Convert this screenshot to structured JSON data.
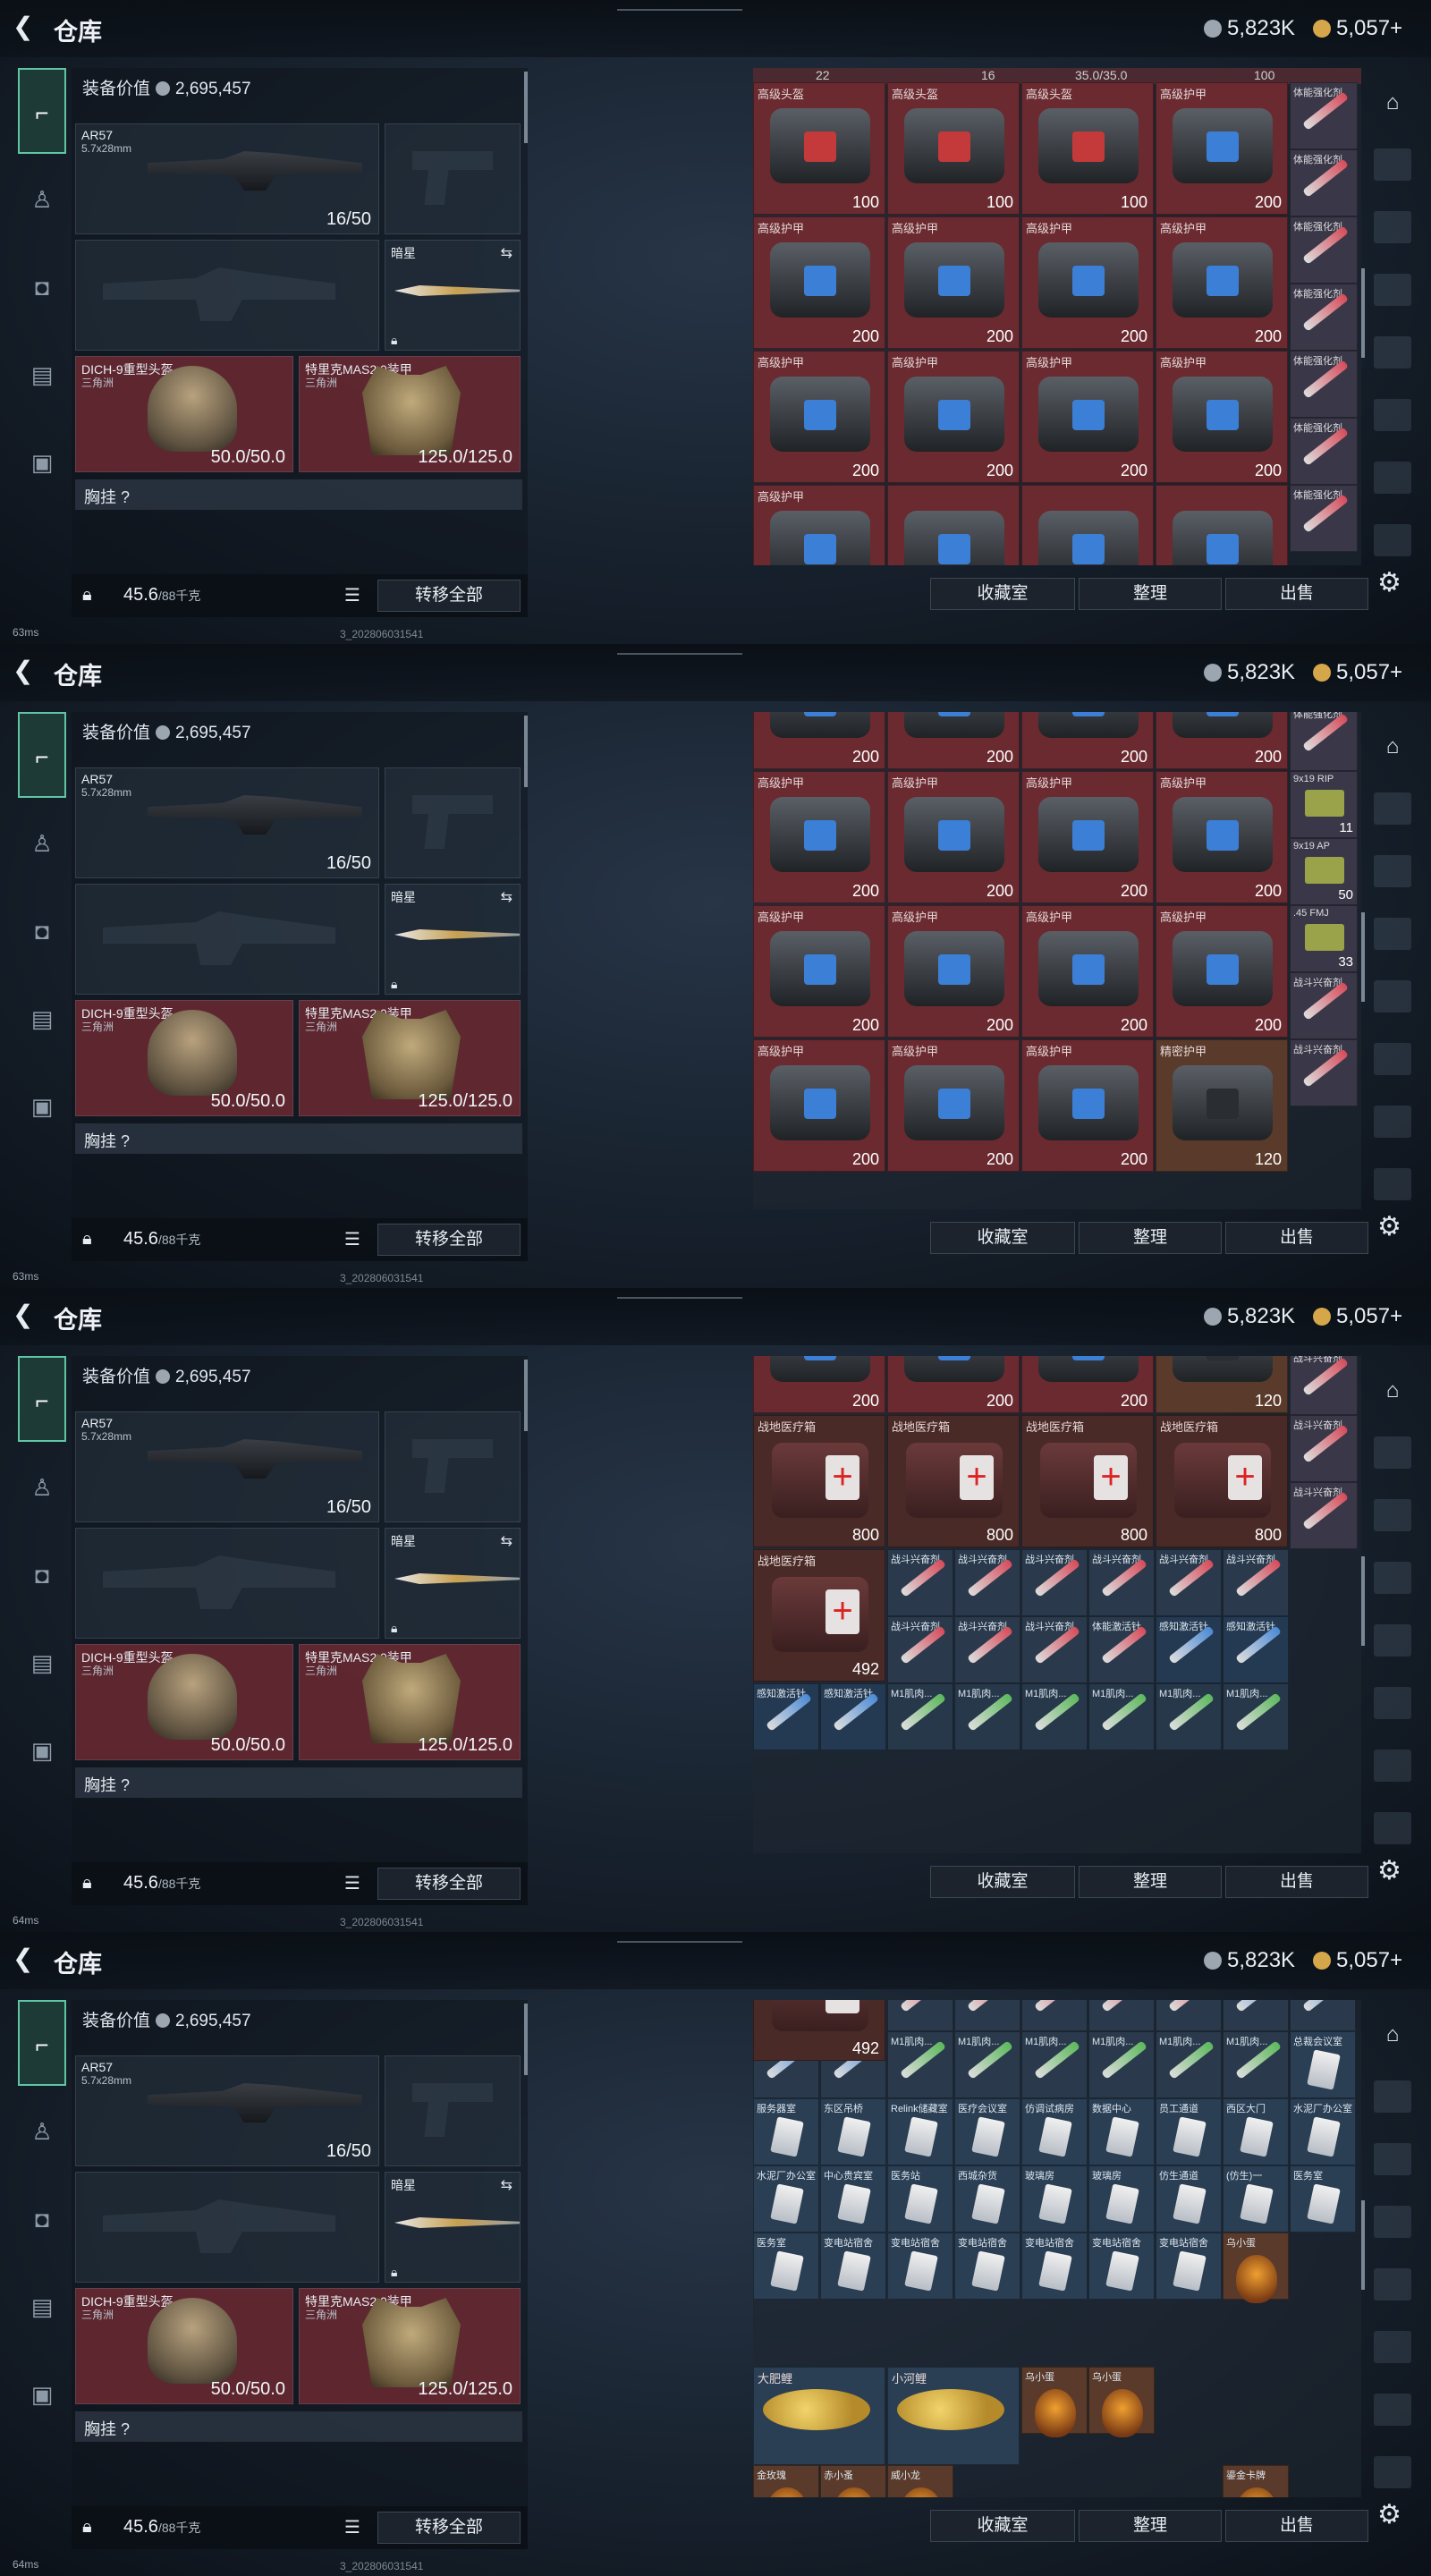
{
  "header": {
    "title": "仓库",
    "currency_silver": "5,823K",
    "currency_gold": "5,057",
    "plus": "+"
  },
  "left": {
    "value_label": "装备价值",
    "value": "2,695,457",
    "weapon_name": "AR57",
    "weapon_caliber": "5.7x28mm",
    "weapon_ammo": "16/50",
    "knife_name": "暗星",
    "helmet_name": "DICH-9重型头盔",
    "helmet_tag": "三角洲",
    "helmet_dur": "50.0/50.0",
    "armor_name": "特里克MAS2.0装甲",
    "armor_dur": "125.0/125.0",
    "chest_label": "胸挂",
    "weight": "45.6",
    "weight_unit": "/88千克",
    "transfer_label": "转移全部"
  },
  "buttons": {
    "collection": "收藏室",
    "sort": "整理",
    "sell": "出售"
  },
  "debug": {
    "ping1": "63ms",
    "ping3": "64ms",
    "version": "3_202806031541"
  },
  "frames": [
    {
      "cells": [
        {
          "n": "高级头盔",
          "v": "100",
          "t": "rb"
        },
        {
          "n": "高级头盔",
          "v": "100",
          "t": "rb"
        },
        {
          "n": "高级头盔",
          "v": "100",
          "t": "rb"
        },
        {
          "n": "高级护甲",
          "v": "200",
          "t": "b"
        },
        {
          "n": "高级护甲",
          "v": "200",
          "t": "b"
        },
        {
          "n": "高级护甲",
          "v": "200",
          "t": "b"
        },
        {
          "n": "高级护甲",
          "v": "200",
          "t": "b"
        },
        {
          "n": "高级护甲",
          "v": "200",
          "t": "b"
        },
        {
          "n": "高级护甲",
          "v": "200",
          "t": "b"
        },
        {
          "n": "高级护甲",
          "v": "200",
          "t": "b"
        },
        {
          "n": "高级护甲",
          "v": "200",
          "t": "b"
        },
        {
          "n": "高级护甲",
          "v": "200",
          "t": "b"
        },
        {
          "n": "高级护甲",
          "v": "",
          "t": "b"
        },
        {
          "n": "",
          "v": "",
          "t": "b"
        },
        {
          "n": "",
          "v": "",
          "t": "b"
        },
        {
          "n": "",
          "v": "",
          "t": "b"
        }
      ],
      "side": [
        {
          "n": "体能强化剂",
          "v": ""
        },
        {
          "n": "体能强化剂",
          "v": ""
        },
        {
          "n": "体能强化剂",
          "v": ""
        },
        {
          "n": "体能强化剂",
          "v": ""
        },
        {
          "n": "体能强化剂",
          "v": ""
        },
        {
          "n": "体能强化剂",
          "v": ""
        },
        {
          "n": "体能强化剂",
          "v": ""
        }
      ],
      "top": [
        "22",
        "16",
        "35.0/35.0",
        "100"
      ]
    },
    {
      "cells": [
        {
          "n": "",
          "v": "200",
          "t": "b"
        },
        {
          "n": "",
          "v": "200",
          "t": "b"
        },
        {
          "n": "",
          "v": "200",
          "t": "b"
        },
        {
          "n": "",
          "v": "200",
          "t": "b"
        },
        {
          "n": "高级护甲",
          "v": "200",
          "t": "b"
        },
        {
          "n": "高级护甲",
          "v": "200",
          "t": "b"
        },
        {
          "n": "高级护甲",
          "v": "200",
          "t": "b"
        },
        {
          "n": "高级护甲",
          "v": "200",
          "t": "b"
        },
        {
          "n": "高级护甲",
          "v": "200",
          "t": "b"
        },
        {
          "n": "高级护甲",
          "v": "200",
          "t": "b"
        },
        {
          "n": "高级护甲",
          "v": "200",
          "t": "b"
        },
        {
          "n": "高级护甲",
          "v": "200",
          "t": "b"
        },
        {
          "n": "高级护甲",
          "v": "200",
          "t": "b"
        },
        {
          "n": "高级护甲",
          "v": "200",
          "t": "b"
        },
        {
          "n": "高级护甲",
          "v": "200",
          "t": "b"
        },
        {
          "n": "精密护甲",
          "v": "120",
          "t": "db"
        }
      ],
      "side": [
        {
          "n": "体能强化剂",
          "v": ""
        },
        {
          "n": "体能强化剂",
          "v": ""
        },
        {
          "n": "9x19 RIP",
          "v": "11"
        },
        {
          "n": "9x19 AP",
          "v": "50"
        },
        {
          "n": ".45 FMJ",
          "v": "33"
        },
        {
          "n": "战斗兴奋剂",
          "v": ""
        },
        {
          "n": "战斗兴奋剂",
          "v": ""
        }
      ],
      "top": []
    },
    {
      "cells": [
        {
          "n": "高级护甲",
          "v": "200",
          "t": "b"
        },
        {
          "n": "高级护甲",
          "v": "200",
          "t": "b"
        },
        {
          "n": "高级护甲",
          "v": "200",
          "t": "b"
        },
        {
          "n": "精密护甲",
          "v": "120",
          "t": "db"
        },
        {
          "n": "战地医疗箱",
          "v": "800",
          "t": "m"
        },
        {
          "n": "战地医疗箱",
          "v": "800",
          "t": "m"
        },
        {
          "n": "战地医疗箱",
          "v": "800",
          "t": "m"
        },
        {
          "n": "战地医疗箱",
          "v": "800",
          "t": "m"
        },
        {
          "n": "战地医疗箱",
          "v": "492",
          "t": "m"
        }
      ],
      "side": [
        {
          "n": "战斗兴奋剂",
          "v": ""
        },
        {
          "n": "战斗兴奋剂",
          "v": ""
        },
        {
          "n": "战斗兴奋剂",
          "v": ""
        },
        {
          "n": "战斗兴奋剂",
          "v": ""
        }
      ],
      "small": [
        {
          "n": "战斗兴奋剂",
          "c": "r"
        },
        {
          "n": "战斗兴奋剂",
          "c": "r"
        },
        {
          "n": "战斗兴奋剂",
          "c": "r"
        },
        {
          "n": "战斗兴奋剂",
          "c": "r"
        },
        {
          "n": "战斗兴奋剂",
          "c": "r"
        },
        {
          "n": "战斗兴奋剂",
          "c": "r"
        },
        {
          "n": "战斗兴奋剂",
          "c": "r"
        },
        {
          "n": "战斗兴奋剂",
          "c": "r"
        },
        {
          "n": "战斗兴奋剂",
          "c": "r"
        },
        {
          "n": "体能激活针",
          "c": "r"
        },
        {
          "n": "感知激活针",
          "c": "b"
        },
        {
          "n": "感知激活针",
          "c": "b"
        },
        {
          "n": "感知激活针",
          "c": "b"
        },
        {
          "n": "感知激活针",
          "c": "b"
        },
        {
          "n": "M1肌肉...",
          "c": "g"
        },
        {
          "n": "M1肌肉...",
          "c": "g"
        },
        {
          "n": "M1肌肉...",
          "c": "g"
        },
        {
          "n": "M1肌肉...",
          "c": "g"
        },
        {
          "n": "M1肌肉...",
          "c": "g"
        },
        {
          "n": "M1肌肉...",
          "c": "g"
        }
      ],
      "top": []
    },
    {
      "cells": [],
      "small": [
        {
          "n": "战斗兴奋剂",
          "c": "r"
        },
        {
          "n": "战斗兴奋剂",
          "c": "r"
        },
        {
          "n": "战斗兴奋剂",
          "c": "r"
        },
        {
          "n": "战斗兴奋剂",
          "c": "r"
        },
        {
          "n": "体能激活针",
          "c": "r"
        },
        {
          "n": "感知激活针",
          "c": "b"
        },
        {
          "n": "感知激活针",
          "c": "b"
        },
        {
          "n": "感知激活针",
          "c": "b"
        },
        {
          "n": "感知激活针",
          "c": "b"
        },
        {
          "n": "M1肌肉...",
          "c": "g"
        },
        {
          "n": "M1肌肉...",
          "c": "g"
        },
        {
          "n": "M1肌肉...",
          "c": "g"
        },
        {
          "n": "M1肌肉...",
          "c": "g"
        },
        {
          "n": "M1肌肉...",
          "c": "g"
        },
        {
          "n": "M1肌肉...",
          "c": "g"
        },
        {
          "n": "总裁会议室",
          "c": "k"
        },
        {
          "n": "服务器室",
          "c": "k"
        },
        {
          "n": "东区吊桥",
          "c": "k"
        },
        {
          "n": "Relink储藏室",
          "c": "k"
        },
        {
          "n": "医疗会议室",
          "c": "k"
        },
        {
          "n": "仿调试病房",
          "c": "k"
        },
        {
          "n": "数据中心",
          "c": "k"
        },
        {
          "n": "员工通道",
          "c": "k"
        },
        {
          "n": "西区大门",
          "c": "k"
        },
        {
          "n": "水泥厂办公室",
          "c": "k"
        },
        {
          "n": "水泥厂办公室",
          "c": "k"
        },
        {
          "n": "中心贵宾室",
          "c": "k"
        },
        {
          "n": "医务站",
          "c": "k"
        },
        {
          "n": "西城杂货",
          "c": "k"
        },
        {
          "n": "玻璃房",
          "c": "k"
        },
        {
          "n": "玻璃房",
          "c": "k"
        },
        {
          "n": "仿生通道",
          "c": "k"
        },
        {
          "n": "(仿生)一",
          "c": "k"
        },
        {
          "n": "医务室",
          "c": "k"
        },
        {
          "n": "医务室",
          "c": "k"
        },
        {
          "n": "变电站宿舍",
          "c": "k"
        },
        {
          "n": "变电站宿舍",
          "c": "k"
        },
        {
          "n": "变电站宿舍",
          "c": "k"
        },
        {
          "n": "变电站宿舍",
          "c": "k"
        },
        {
          "n": "变电站宿舍",
          "c": "k"
        },
        {
          "n": "变电站宿舍",
          "c": "k"
        },
        {
          "n": "乌小蛋",
          "c": "e"
        }
      ],
      "big2": [
        {
          "n": "大肥鲤"
        },
        {
          "n": "小河鲤"
        }
      ],
      "eggs": [
        {
          "n": "乌小蛋"
        },
        {
          "n": "乌小蛋"
        },
        {
          "n": "金玫瑰"
        },
        {
          "n": "赤小蚤"
        },
        {
          "n": "威小龙"
        },
        {
          "n": "鎏金卡牌"
        }
      ],
      "top": []
    }
  ]
}
